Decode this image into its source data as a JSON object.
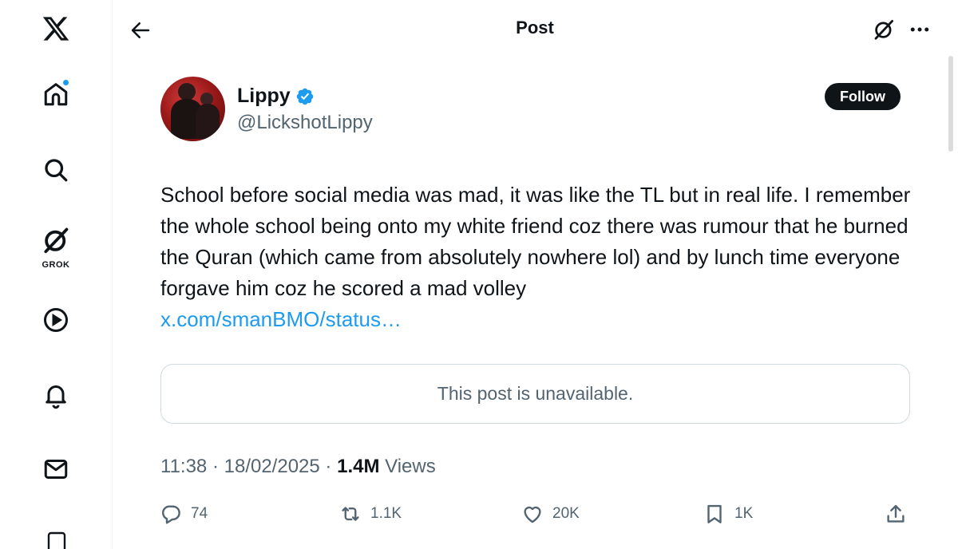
{
  "header": {
    "title": "Post"
  },
  "nav": {
    "grok_label": "GROK"
  },
  "author": {
    "name": "Lippy",
    "handle": "@LickshotLippy",
    "follow_label": "Follow"
  },
  "tweet": {
    "text": "School before social media was mad, it was like the TL but in real life. I remember the whole school being onto my white friend coz there was rumour that he burned the Quran (which came from absolutely nowhere lol) and by lunch time everyone forgave him coz he scored a mad volley",
    "link": "x.com/smanBMO/status…",
    "quoted_unavailable": "This post is unavailable."
  },
  "meta": {
    "time": "11:38",
    "sep1": "·",
    "date": "18/02/2025",
    "sep2": "·",
    "views_count": "1.4M",
    "views_label": "Views"
  },
  "actions": {
    "replies": "74",
    "reposts": "1.1K",
    "likes": "20K",
    "bookmarks": "1K"
  },
  "colors": {
    "accent": "#1d9bf0",
    "text": "#0f1419",
    "secondary": "#536471",
    "border": "#cfd9de"
  }
}
